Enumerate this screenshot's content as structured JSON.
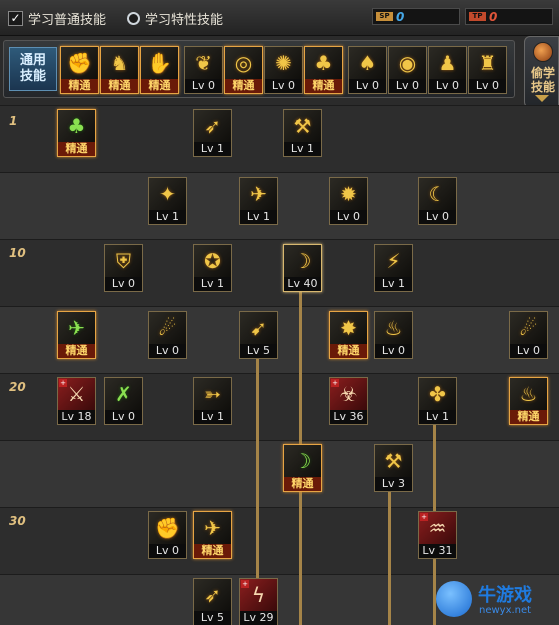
{
  "header": {
    "tab_normal": "学习普通技能",
    "tab_special": "学习特性技能",
    "sp_label": "SP",
    "sp_value": "0",
    "tp_label": "TP",
    "tp_value": "0"
  },
  "common": {
    "label": "通用\n技能",
    "skills": [
      {
        "icon": "✊",
        "label": "精通",
        "master": true
      },
      {
        "icon": "♞",
        "label": "精通",
        "master": true
      },
      {
        "icon": "✋",
        "label": "精通",
        "master": true
      },
      {
        "icon": "❦",
        "label": "Lv 0",
        "master": false
      },
      {
        "icon": "◎",
        "label": "精通",
        "master": true
      },
      {
        "icon": "✺",
        "label": "Lv 0",
        "master": false
      },
      {
        "icon": "♣",
        "label": "精通",
        "master": true
      },
      {
        "icon": "♠",
        "label": "Lv 0",
        "master": false
      },
      {
        "icon": "◉",
        "label": "Lv 0",
        "master": false
      },
      {
        "icon": "♟",
        "label": "Lv 0",
        "master": false
      },
      {
        "icon": "♜",
        "label": "Lv 0",
        "master": false
      }
    ]
  },
  "steal": {
    "label": "偷学\n技能"
  },
  "level_markers": [
    "1",
    "10",
    "20",
    "30"
  ],
  "tree": [
    {
      "icon": "♣",
      "label": "精通",
      "master": true,
      "green": true
    },
    {
      "icon": "➶",
      "label": "Lv 1"
    },
    {
      "icon": "⚒",
      "label": "Lv 1"
    },
    {
      "icon": "✦",
      "label": "Lv 1"
    },
    {
      "icon": "✈",
      "label": "Lv 1"
    },
    {
      "icon": "✹",
      "label": "Lv 0"
    },
    {
      "icon": "☾",
      "label": "Lv 0"
    },
    {
      "icon": "⛨",
      "label": "Lv 0"
    },
    {
      "icon": "✪",
      "label": "Lv 1"
    },
    {
      "icon": "☽",
      "label": "Lv 40",
      "hl": true
    },
    {
      "icon": "⚡",
      "label": "Lv 1"
    },
    {
      "icon": "✈",
      "label": "精通",
      "master": true,
      "green": true
    },
    {
      "icon": "☄",
      "label": "Lv 0"
    },
    {
      "icon": "➹",
      "label": "Lv 5"
    },
    {
      "icon": "✸",
      "label": "精通",
      "master": true
    },
    {
      "icon": "♨",
      "label": "Lv 0"
    },
    {
      "icon": "☄",
      "label": "Lv 0"
    },
    {
      "icon": "⚔",
      "label": "Lv 18",
      "red": true
    },
    {
      "icon": "✗",
      "label": "Lv 0",
      "green": true
    },
    {
      "icon": "➳",
      "label": "Lv 1"
    },
    {
      "icon": "☣",
      "label": "Lv 36",
      "red": true
    },
    {
      "icon": "✤",
      "label": "Lv 1"
    },
    {
      "icon": "♨",
      "label": "精通",
      "master": true
    },
    {
      "icon": "☽",
      "label": "精通",
      "master": true,
      "green": true
    },
    {
      "icon": "⚒",
      "label": "Lv 3"
    },
    {
      "icon": "✊",
      "label": "Lv 0"
    },
    {
      "icon": "✈",
      "label": "精通",
      "master": true
    },
    {
      "icon": "♒",
      "label": "Lv 31",
      "red": true
    },
    {
      "icon": "➶",
      "label": "Lv 5"
    },
    {
      "icon": "ϟ",
      "label": "Lv 29",
      "red": true
    }
  ],
  "watermark": {
    "name": "牛游戏",
    "url": "newyx.net"
  }
}
